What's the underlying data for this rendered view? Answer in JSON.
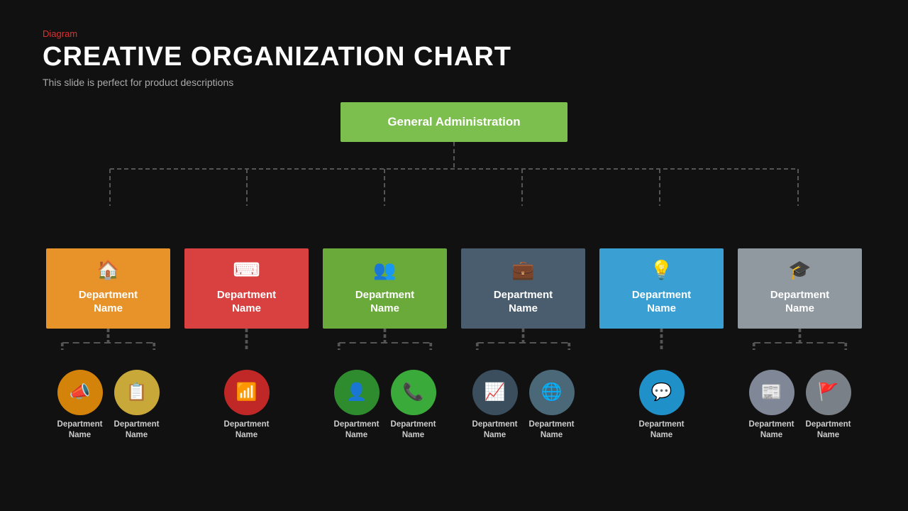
{
  "header": {
    "diagram_label": "Diagram",
    "title": "CREATIVE ORGANIZATION CHART",
    "subtitle": "This slide is perfect for product descriptions"
  },
  "top_node": {
    "label": "General Administration"
  },
  "departments": [
    {
      "id": "dept-1",
      "color_class": "dept-orange",
      "icon": "🏠",
      "name": "Department\nName",
      "sub_items": [
        {
          "icon": "📣",
          "color_class": "circle-orange",
          "label": "Department\nName"
        },
        {
          "icon": "📋",
          "color_class": "circle-tan",
          "label": "Department\nName"
        }
      ]
    },
    {
      "id": "dept-2",
      "color_class": "dept-red",
      "icon": "⌨",
      "name": "Department\nName",
      "sub_items": [
        {
          "icon": "📶",
          "color_class": "circle-red",
          "label": "Department\nName"
        }
      ]
    },
    {
      "id": "dept-3",
      "color_class": "dept-green",
      "icon": "👥",
      "name": "Department\nName",
      "sub_items": [
        {
          "icon": "👤",
          "color_class": "circle-green-dark",
          "label": "Department\nName"
        },
        {
          "icon": "📞",
          "color_class": "circle-green-phone",
          "label": "Department\nName"
        }
      ]
    },
    {
      "id": "dept-4",
      "color_class": "dept-slate",
      "icon": "💼",
      "name": "Department\nName",
      "sub_items": [
        {
          "icon": "📈",
          "color_class": "circle-slate",
          "label": "Department\nName"
        },
        {
          "icon": "🌐",
          "color_class": "circle-blue-globe",
          "label": "Department\nName"
        }
      ]
    },
    {
      "id": "dept-5",
      "color_class": "dept-blue",
      "icon": "💡",
      "name": "Department\nName",
      "sub_items": [
        {
          "icon": "💬",
          "color_class": "circle-blue",
          "label": "Department\nName"
        }
      ]
    },
    {
      "id": "dept-6",
      "color_class": "dept-gray",
      "icon": "🎓",
      "name": "Department\nName",
      "sub_items": [
        {
          "icon": "📰",
          "color_class": "circle-gray-light",
          "label": "Department\nName"
        },
        {
          "icon": "🚩",
          "color_class": "circle-gray-flag",
          "label": "Department\nName"
        }
      ]
    }
  ]
}
